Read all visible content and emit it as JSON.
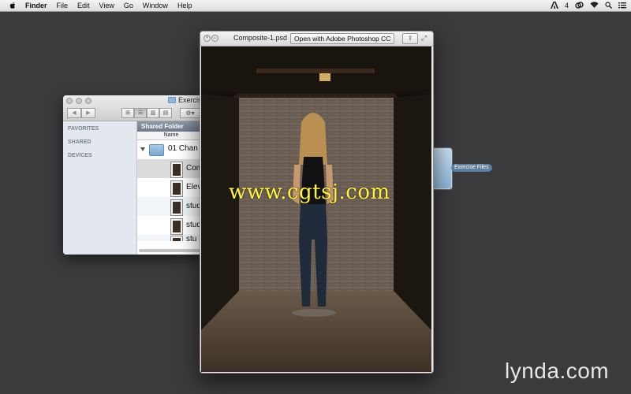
{
  "menubar": {
    "app": "Finder",
    "items": [
      "File",
      "Edit",
      "View",
      "Go",
      "Window",
      "Help"
    ],
    "status_badge": "4"
  },
  "finder": {
    "title": "Exercis",
    "sidebar_sections": [
      "FAVORITES",
      "SHARED",
      "DEVICES"
    ],
    "path": "Shared Folder",
    "column_name": "Name",
    "folder_row": "01 Chan",
    "files": [
      "Com",
      "Elev",
      "stud",
      "stud",
      "stu"
    ]
  },
  "quicklook": {
    "title": "Composite-1.psd",
    "open_button": "Open with Adobe Photoshop CC"
  },
  "watermark": "www.cgtsj.com",
  "desktop_folder_label": "Exercise Files",
  "brand": "lynda.com",
  "colors": {
    "desktop": "#3b3b3d",
    "sidebar": "#e3e8ee",
    "watermark": "#fff43a"
  }
}
